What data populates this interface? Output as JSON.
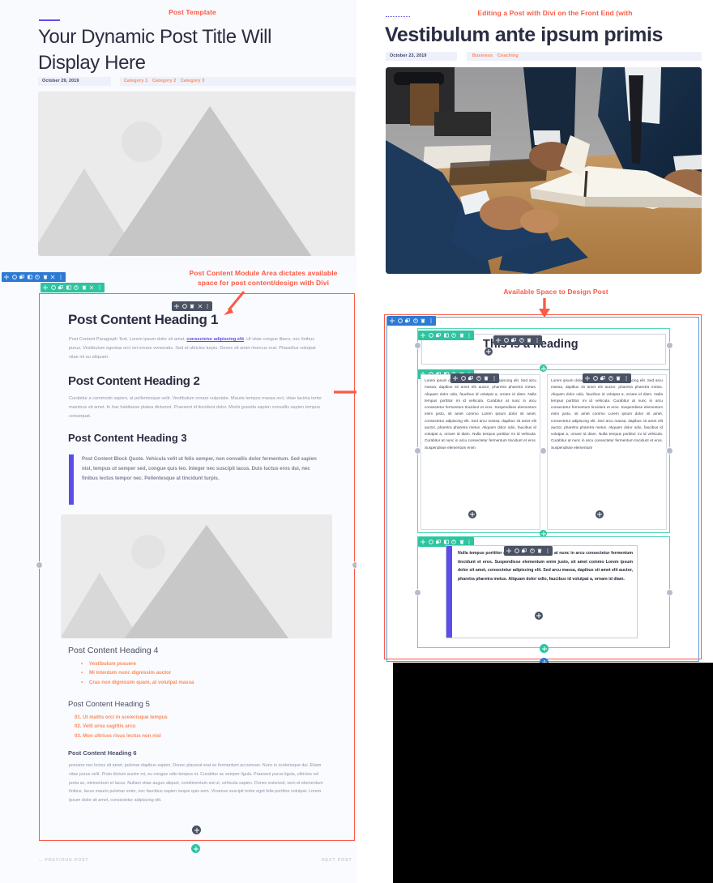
{
  "annotations": {
    "left_title": "Post Template",
    "right_title": "Editing a Post with Divi on the Front End (with",
    "left_note_line1": "Post Content Module Area dictates available",
    "left_note_line2": "space for post content/design with Divi",
    "right_note": "Available Space to Design Post",
    "accent_color": "#fb5a45"
  },
  "left_panel": {
    "post_title": "Your Dynamic Post Title Will Display Here",
    "date": "October 29, 2019",
    "categories": [
      "Category 1",
      "Category 2",
      "Category 3"
    ],
    "featured_image": "image-placeholder",
    "content": {
      "heading1": "Post Content Heading 1",
      "paragraph1_before": "Post Content Paragraph Text. Lorem ipsum dolor sit amet, ",
      "paragraph1_link": "consectetur adipiscing elit",
      "paragraph1_after": ". Ut vitae congue libero, nec finibus purus. Vestibulum egestas orci vel ornare venenatis. Sed et ultricies turpis. Donec sit amet rhoncus erat. Phasellus volutpat vitae mi eu aliquam.",
      "heading2": "Post Content Heading 2",
      "paragraph2": "Curabitur a commodo sapien, at pellentesque velit. Vestibulum ornare vulputate. Mauris tempus massa orci, vitae lacinia tortor maximus sit amet. In hac habitasse platea dictumst. Praesent id tincidunt dolor. Morbi gravida sapien convallis sapien tempus consequat.",
      "heading3": "Post Content Heading 3",
      "blockquote": "Post Content Block Quote. Vehicula velit ut felis semper, non convallis dolor fermentum. Sed sapien nisl, tempus ut semper sed, congue quis leo. Integer nec suscipit lacus. Duis luctus eros dui, nec finibus lectus tempor nec. Pellentesque at tincidunt turpis.",
      "inline_image": "image-placeholder",
      "heading4": "Post Content Heading 4",
      "bullet_list": [
        "Vestibulum posuere",
        "Mi interdum nunc dignissim auctor",
        "Cras non dignissim quam, at volutpat massa"
      ],
      "heading5": "Post Content Heading 5",
      "numbered_list": [
        "01. Ut mattis orci in scelerisque tempus",
        "02. Velit urna sagittis arcu",
        "03. Mon ultrices risus lectus non nisl"
      ],
      "heading6": "Post Content Heading 6",
      "paragraph6": "posuere nec lectus sit amet, pulvinar dapibus sapien. Donec placerat erat ac fermentum accumsan. Nunc in scelerisque dui. Etiam vitae purus velit. Proin dictum auctor mi, eu congue odio tempus et. Curabitur ac semper ligula. Praesent purus ligula, ultricies vel porta ac, elementum et lacus. Nullam vitae augue aliquet, condimentum est ut, vehicula sapien. Donec euismod, sem et elementum finibus, lacus mauris pulvinar enim, nec faucibus sapien neque quis sem. Vivamus suscipit tortor eget felis porttitor volutpat. Lorem ipsum dolor sit amet, consectetur adipiscing elit."
    },
    "footer": {
      "previous": "← PREVIOUS POST",
      "next": "NEXT POST →"
    }
  },
  "right_panel": {
    "post_title": "Vestibulum ante ipsum primis",
    "date": "October 23, 2019",
    "categories": [
      "Business",
      "Coaching"
    ],
    "featured_image": "business-meeting-photo",
    "builder": {
      "heading": "This is a heading",
      "column_left_text": "Lorem ipsum dolor sit amet, consectetur adipiscing elit. Sed arcu massa, dapibus sit amet elit auctor, pharetra pharetra metus. Aliquam dolor odio, faucibus id volutpat a, ornare id diam. Nulla tempus porttitor mi id vehicula. Curabitur at nunc in arcu consectetur fermentum tincidunt et eros. Suspendisse elementum enim justo, sit amet commo Lorem ipsum dolor sit amet, consectetur adipiscing elit. Sed arcu massa, dapibus sit amet elit auctor, pharetra pharetra metus. Aliquam dolor odio, faucibus id volutpat a, ornare id diam. Nulla tempus porttitor mi id vehicula. Curabitur at nunc in arcu consectetur fermentum tincidunt et eros. Suspendisse elementum enim",
      "column_right_text": "Lorem ipsum dolor sit amet, consectetur adipiscing elit. Sed arcu massa, dapibus sit amet elit auctor, pharetra pharetra metus. Aliquam dolor odio, faucibus id volutpat a, ornare id diam. Nulla tempus porttitor mi id vehicula. Curabitur at nunc in arcu consectetur fermentum tincidunt et eros. Suspendisse elementum enim justo, sit amet commo Lorem ipsum dolor sit amet, consectetur adipiscing elit. Sed arcu massa, dapibus sit amet elit auctor, pharetra pharetra metus. Aliquam dolor odio, faucibus id volutpat a, ornare id diam. Nulla tempus porttitor mi id vehicula. Curabitur at nunc in arcu consectetur fermentum tincidunt et eros. Suspendisse elementum",
      "blockquote": "Nulla tempus porttitor mi id vehicula. Curabitur at nunc in arcu consectetur fermentum tincidunt et eros. Suspendisse elementum enim justo, sit amet commo Lorem ipsum dolor sit amet, consectetur adipiscing elit. Sed arcu massa, dapibus sit amet elit auctor, pharetra pharetra metus. Aliquam dolor odio, faucibus id volutpat a, ornare id diam."
    }
  },
  "toolbar_icons": [
    "move-icon",
    "gear-icon",
    "duplicate-icon",
    "layout-icon",
    "save-icon",
    "trash-icon",
    "close-icon",
    "more-options-icon"
  ],
  "colors": {
    "divi_blue": "#2d7ad4",
    "divi_green": "#2ec4a0",
    "divi_dark": "#4a5264",
    "annotation_red": "#fb5a45",
    "quote_purple": "#5b4ee8",
    "list_orange": "#fb8a5a"
  }
}
